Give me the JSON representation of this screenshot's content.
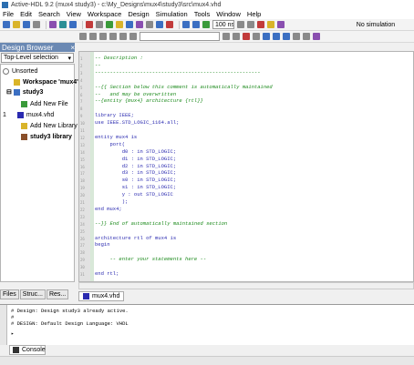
{
  "title": "Active-HDL 9.2 (mux4 study3) - c:\\My_Designs\\mux4\\study3\\src\\mux4.vhd",
  "menu": [
    "File",
    "Edit",
    "Search",
    "View",
    "Workspace",
    "Design",
    "Simulation",
    "Tools",
    "Window",
    "Help"
  ],
  "toolbar": {
    "sim_time": "100 ns",
    "sim_status": "No simulation"
  },
  "design_browser": {
    "title": "Design Browser",
    "selector_value": "Top-Level selection",
    "tree": [
      {
        "label": "Unsorted"
      },
      {
        "label": "Workspace 'mux4':"
      },
      {
        "label": "study3"
      },
      {
        "label": "Add New File"
      },
      {
        "label": "mux4.vhd",
        "marker": "1"
      },
      {
        "label": "Add New Library"
      },
      {
        "label": "study3 library"
      }
    ],
    "tabs": [
      "Files",
      "Struc...",
      "Res..."
    ]
  },
  "editor": {
    "file_tab": "mux4.vhd",
    "lines": [
      {
        "n": "1",
        "text": "-- Description :",
        "cls": "cm"
      },
      {
        "n": "2",
        "text": "--",
        "cls": "cm"
      },
      {
        "n": "3",
        "text": "-------------------------------------------------------",
        "cls": "cm"
      },
      {
        "n": "4",
        "text": "",
        "cls": "tx"
      },
      {
        "n": "5",
        "text": "--{{ Section below this comment is automatically maintained",
        "cls": "cm"
      },
      {
        "n": "6",
        "text": "--   and may be overwritten",
        "cls": "cm"
      },
      {
        "n": "7",
        "text": "--{entity {mux4} architecture {rtl}}",
        "cls": "cm"
      },
      {
        "n": "8",
        "text": "",
        "cls": "tx"
      },
      {
        "n": "9",
        "text": "library IEEE;",
        "cls": "kw"
      },
      {
        "n": "10",
        "text": "use IEEE.STD_LOGIC_1164.all;",
        "cls": "kw"
      },
      {
        "n": "11",
        "text": "",
        "cls": "tx"
      },
      {
        "n": "12",
        "text": "entity mux4 is",
        "cls": "kw"
      },
      {
        "n": "13",
        "text": "     port(",
        "cls": "kw"
      },
      {
        "n": "14",
        "text": "         d0 : in STD_LOGIC;",
        "cls": "kw"
      },
      {
        "n": "15",
        "text": "         d1 : in STD_LOGIC;",
        "cls": "kw"
      },
      {
        "n": "16",
        "text": "         d2 : in STD_LOGIC;",
        "cls": "kw"
      },
      {
        "n": "17",
        "text": "         d3 : in STD_LOGIC;",
        "cls": "kw"
      },
      {
        "n": "18",
        "text": "         s0 : in STD_LOGIC;",
        "cls": "kw"
      },
      {
        "n": "19",
        "text": "         s1 : in STD_LOGIC;",
        "cls": "kw"
      },
      {
        "n": "20",
        "text": "         y : out STD_LOGIC",
        "cls": "kw"
      },
      {
        "n": "21",
        "text": "         );",
        "cls": "kw"
      },
      {
        "n": "22",
        "text": "end mux4;",
        "cls": "kw"
      },
      {
        "n": "23",
        "text": "",
        "cls": "tx"
      },
      {
        "n": "24",
        "text": "--}} End of automatically maintained section",
        "cls": "cm"
      },
      {
        "n": "25",
        "text": "",
        "cls": "tx"
      },
      {
        "n": "26",
        "text": "architecture rtl of mux4 is",
        "cls": "kw"
      },
      {
        "n": "27",
        "text": "begin",
        "cls": "kw"
      },
      {
        "n": "28",
        "text": "",
        "cls": "tx"
      },
      {
        "n": "29",
        "text": "     -- enter your statements here --",
        "cls": "cm"
      },
      {
        "n": "30",
        "text": "",
        "cls": "tx"
      },
      {
        "n": "31",
        "text": "end rtl;",
        "cls": "kw"
      }
    ]
  },
  "console": {
    "lines": [
      "# Design: Design study3 already active.",
      "#",
      "# DESIGN: Default Design Language: VHDL"
    ],
    "tab": "Console"
  }
}
